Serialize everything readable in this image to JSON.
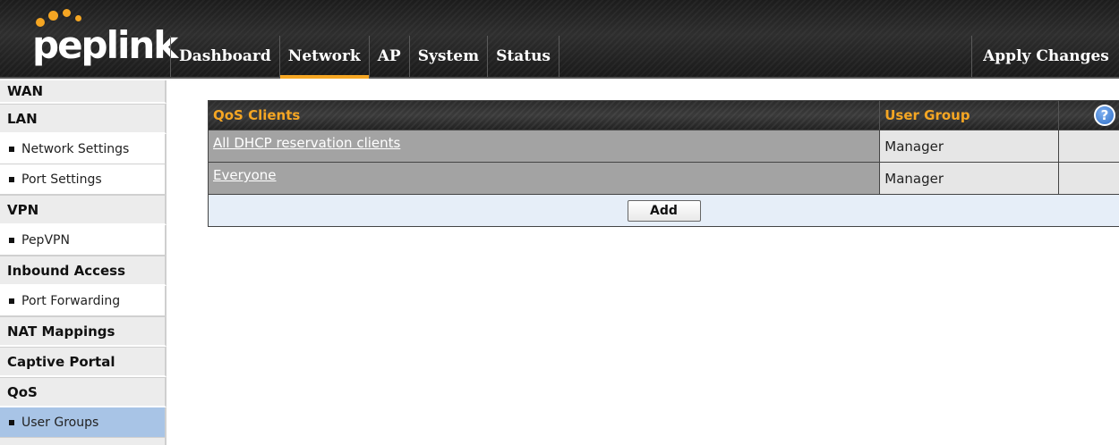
{
  "brand": {
    "logo_text": "peplink",
    "accent_color": "#f5a623"
  },
  "nav": {
    "items": [
      {
        "label": "Dashboard",
        "active": false
      },
      {
        "label": "Network",
        "active": true
      },
      {
        "label": "AP",
        "active": false
      },
      {
        "label": "System",
        "active": false
      },
      {
        "label": "Status",
        "active": false
      }
    ],
    "apply_label": "Apply Changes"
  },
  "sidebar": {
    "items": [
      {
        "type": "head",
        "label": "WAN"
      },
      {
        "type": "head",
        "label": "LAN"
      },
      {
        "type": "sub",
        "label": "Network Settings"
      },
      {
        "type": "sub",
        "label": "Port Settings"
      },
      {
        "type": "head",
        "label": "VPN"
      },
      {
        "type": "sub",
        "label": "PepVPN"
      },
      {
        "type": "head",
        "label": "Inbound Access"
      },
      {
        "type": "sub",
        "label": "Port Forwarding"
      },
      {
        "type": "head",
        "label": "NAT Mappings"
      },
      {
        "type": "head",
        "label": "Captive Portal"
      },
      {
        "type": "head",
        "label": "QoS"
      },
      {
        "type": "sub",
        "label": "User Groups",
        "selected": true
      }
    ]
  },
  "qos_table": {
    "headers": {
      "clients": "QoS Clients",
      "user_group": "User Group",
      "help_icon": "help-icon"
    },
    "rows": [
      {
        "client": "All DHCP reservation clients",
        "group": "Manager"
      },
      {
        "client": "Everyone",
        "group": "Manager"
      }
    ],
    "add_label": "Add"
  }
}
